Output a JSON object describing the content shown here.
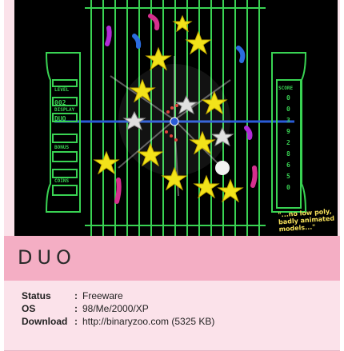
{
  "game": {
    "title": "DUO",
    "screenshot": {
      "hud_left": {
        "level_label": "LEVEL",
        "level_value": "002",
        "display_label": "DISPLAY",
        "mode_label": "DUO",
        "bonus_label": "BONUS",
        "coins_label": "COINS"
      },
      "hud_right": {
        "score_label": "SCORE",
        "score_digits": [
          "0",
          "0",
          "3",
          "9",
          "2",
          "8",
          "6",
          "5",
          "0"
        ]
      },
      "caption": "\"...no low poly,\nbadly animated\nmodels...\""
    },
    "details": [
      {
        "label": "Status",
        "value": "Freeware"
      },
      {
        "label": "OS",
        "value": "98/Me/2000/XP"
      },
      {
        "label": "Download",
        "value": "http://binaryzoo.com (5325 KB)"
      }
    ]
  },
  "colors": {
    "card_bg": "#fbe2ea",
    "title_bar": "#f4aec4",
    "grid_green": "#39d353",
    "star_yellow": "#f2e21a",
    "accent_blue": "#2a5bd7"
  }
}
